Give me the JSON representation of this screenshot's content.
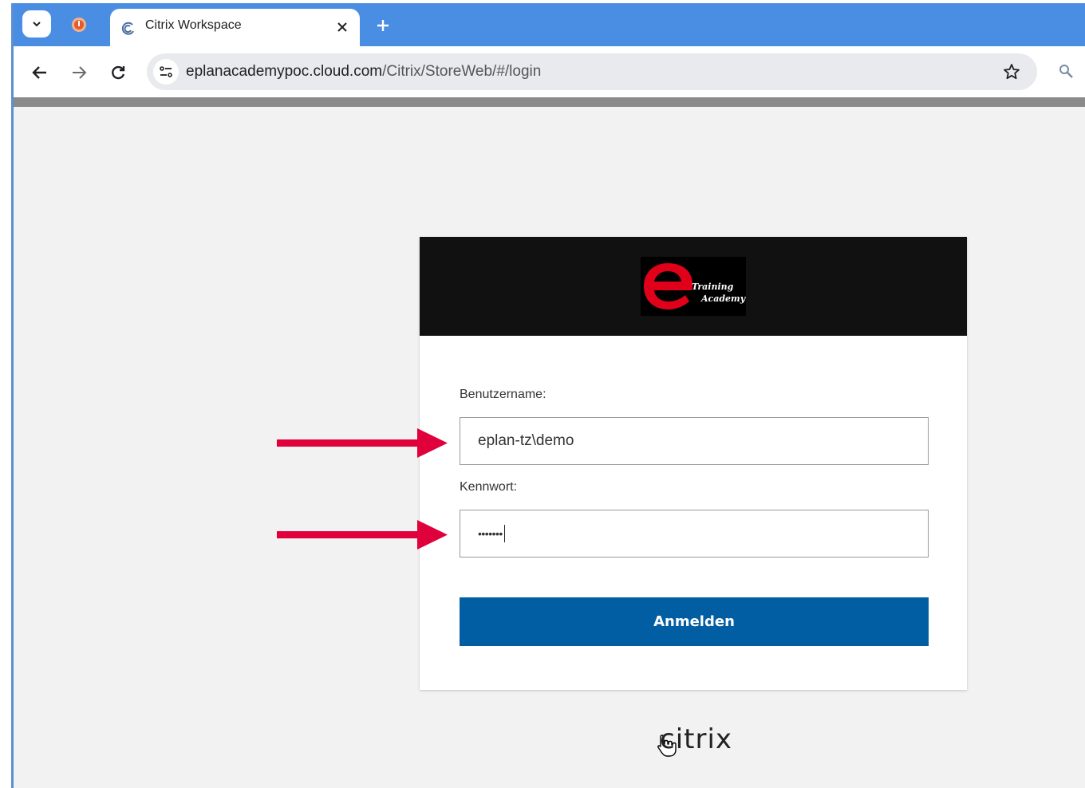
{
  "browser": {
    "tab_title": "Citrix Workspace",
    "url_host": "eplanacademypoc.cloud.com",
    "url_path": "/Citrix/StoreWeb/#/login"
  },
  "login": {
    "logo_line1": "Training",
    "logo_line2": "Academy",
    "username_label": "Benutzername:",
    "username_value": "eplan-tz\\demo",
    "password_label": "Kennwort:",
    "password_mask": "•••••••",
    "submit_label": "Anmelden"
  },
  "footer": {
    "brand": "citrix"
  },
  "colors": {
    "tabstrip": "#4a8ee3",
    "button": "#015ea2",
    "header": "#111111",
    "logo_red": "#e1001a",
    "annotation_arrow": "#e0003c"
  }
}
